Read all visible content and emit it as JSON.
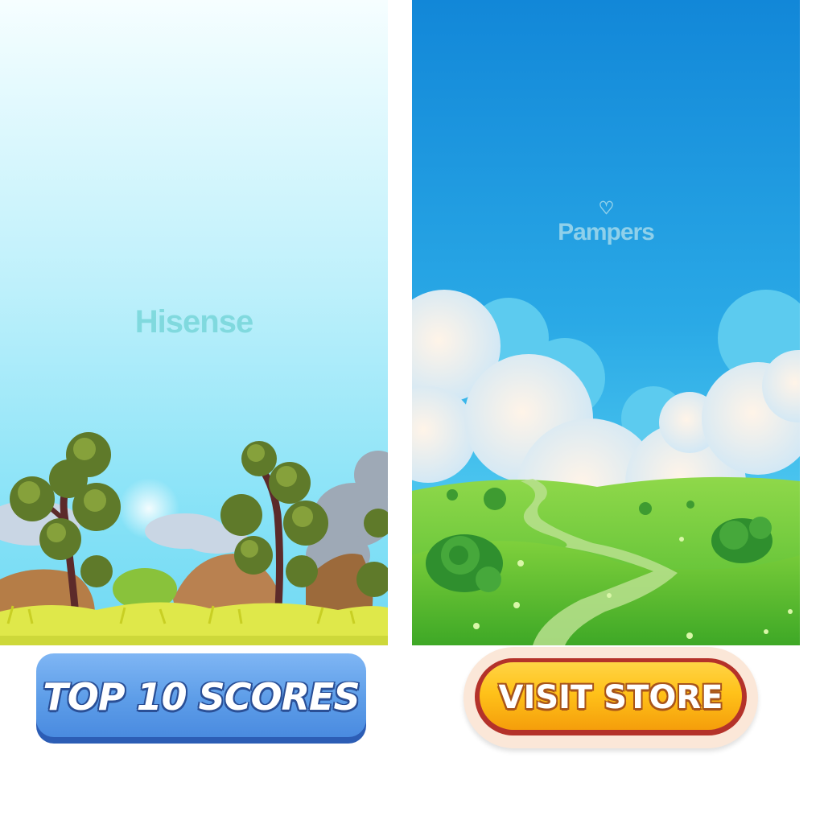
{
  "left_panel": {
    "sponsor_logo": "Hisense"
  },
  "right_panel": {
    "sponsor_logo": "Pampers",
    "logo_mark": "heart-icon"
  },
  "buttons": {
    "top_scores": {
      "label": "TOP 10 SCORES",
      "color": "#5d9de8"
    },
    "visit_store": {
      "label": "VISIT STORE",
      "color": "#ffc21a"
    }
  }
}
